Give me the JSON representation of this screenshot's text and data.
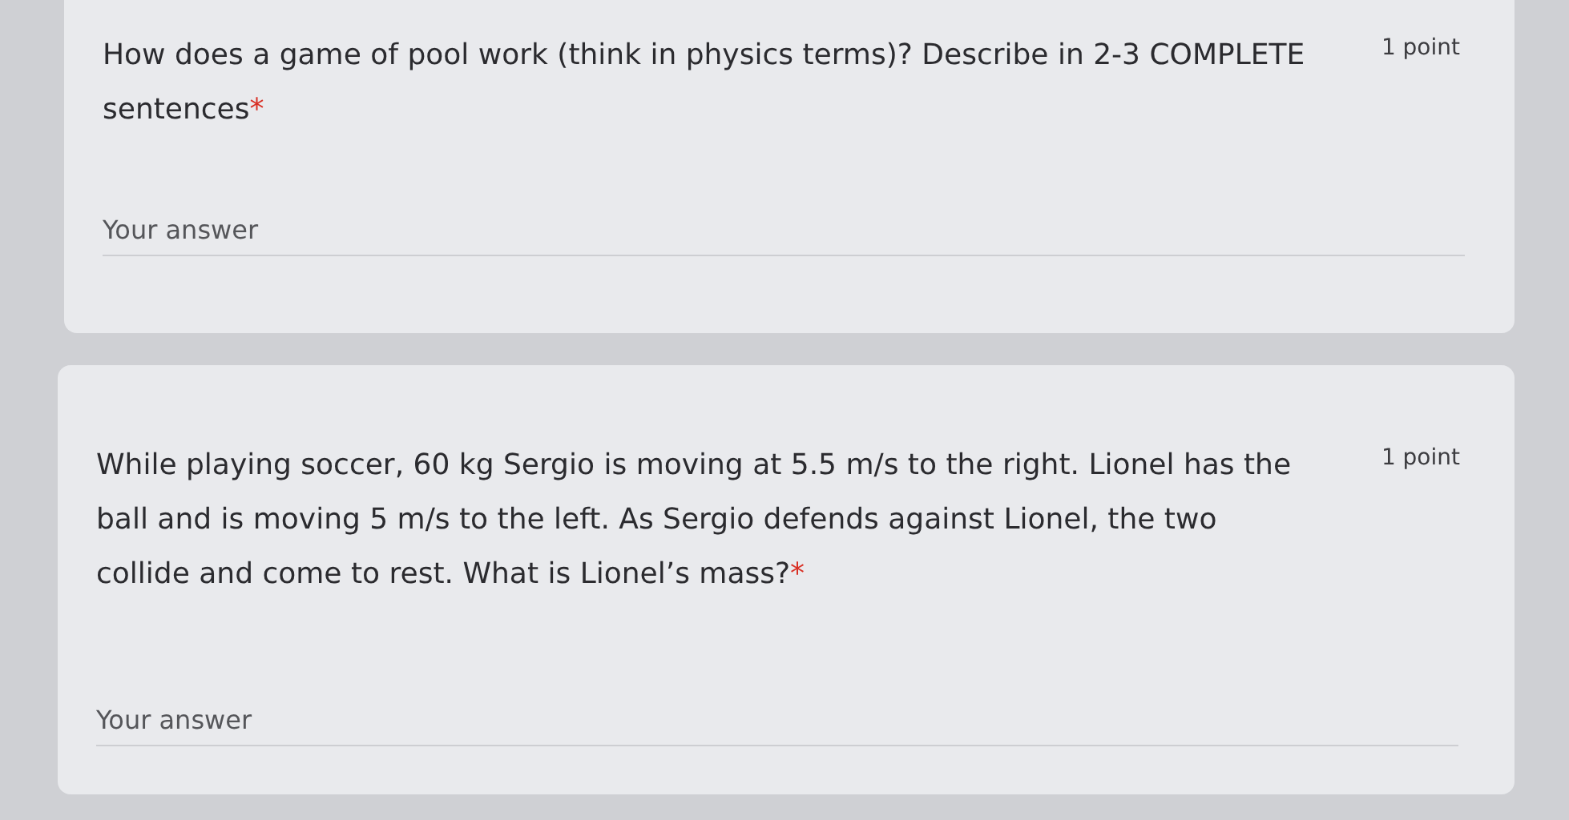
{
  "questions": [
    {
      "text": "How does a game of pool work (think in physics terms)? Describe in 2-3 COMPLETE sentences",
      "required_mark": "*",
      "points": "1 point",
      "answer": {
        "placeholder": "Your answer"
      }
    },
    {
      "text": "While playing soccer, 60 kg Sergio is moving at 5.5 m/s to the right. Lionel has the ball and is moving 5 m/s to the left. As Sergio defends against Lionel, the two collide and come to rest. What is Lionel’s mass?",
      "required_mark": "*",
      "points": "1 point",
      "answer": {
        "placeholder": "Your answer"
      }
    }
  ]
}
